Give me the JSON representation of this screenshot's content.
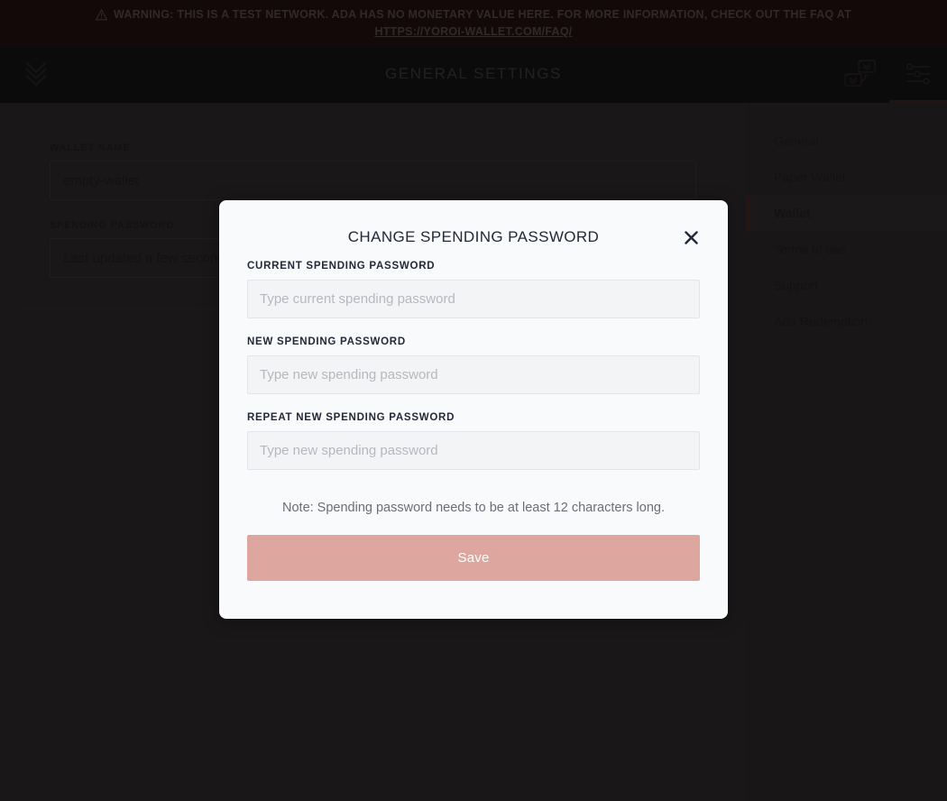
{
  "banner": {
    "icon": "warning-triangle-icon",
    "line1": "WARNING: THIS IS A TEST NETWORK. ADA HAS NO MONETARY VALUE HERE. FOR MORE INFORMATION, CHECK OUT THE FAQ AT",
    "link": "HTTPS://YOROI-WALLET.COM/FAQ/",
    "background": "#2b1515",
    "text_color": "#6d5c5c"
  },
  "topbar": {
    "logo": "yoroi-logo-icon",
    "title": "GENERAL SETTINGS",
    "wallet_switch_icon": "wallet-switch-icon",
    "settings_icon": "sliders-settings-icon",
    "active_tab_color": "#4d2e2c"
  },
  "settings": {
    "wallet_name_label": "WALLET NAME",
    "wallet_name_value": "empty-wallet",
    "spending_password_label": "SPENDING PASSWORD",
    "spending_password_value": "Last updated a few seconds ago"
  },
  "sidebar": {
    "items": [
      {
        "label": "General",
        "active": false
      },
      {
        "label": "Paper Wallet",
        "active": false
      },
      {
        "label": "Wallet",
        "active": true
      },
      {
        "label": "Terms of use",
        "active": false
      },
      {
        "label": "Support",
        "active": false
      },
      {
        "label": "Ada Redemption",
        "active": false
      }
    ],
    "active_accent": "#533130"
  },
  "modal": {
    "title": "CHANGE SPENDING PASSWORD",
    "close_icon": "close-x-icon",
    "fields": [
      {
        "label": "CURRENT SPENDING PASSWORD",
        "placeholder": "Type current spending password",
        "value": ""
      },
      {
        "label": "NEW SPENDING PASSWORD",
        "placeholder": "Type new spending password",
        "value": ""
      },
      {
        "label": "REPEAT NEW SPENDING PASSWORD",
        "placeholder": "Type new spending password",
        "value": ""
      }
    ],
    "note": "Note: Spending password needs to be at least 12 characters long.",
    "save_label": "Save",
    "save_color": "#dda79f",
    "background": "#f9fafc"
  }
}
